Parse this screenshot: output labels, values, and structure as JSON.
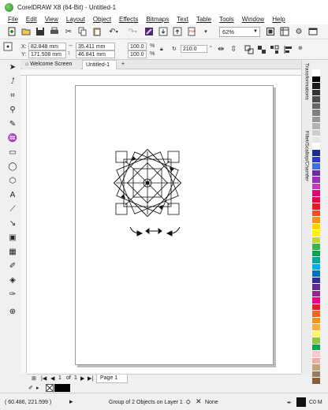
{
  "app": {
    "title": "CorelDRAW X8 (64-Bit) - Untitled-1"
  },
  "menu": [
    "File",
    "Edit",
    "View",
    "Layout",
    "Object",
    "Effects",
    "Bitmaps",
    "Text",
    "Table",
    "Tools",
    "Window",
    "Help"
  ],
  "toolbar": {
    "zoom": "62%"
  },
  "property_bar": {
    "x_label": "X:",
    "x": "82.848 mm",
    "y_label": "Y:",
    "y": "171.508 mm",
    "width": "35.411 mm",
    "height": "46.841 mm",
    "scale_x": "100.0",
    "scale_y": "100.0",
    "pct": "%",
    "angle": "210.0"
  },
  "tabs": [
    {
      "label": "Welcome Screen"
    },
    {
      "label": "Untitled-1"
    }
  ],
  "dockers": [
    "Transformations",
    "Fillet/Scallop/Chamfer"
  ],
  "page_nav": {
    "current": "1",
    "of_label": "of",
    "total": "1",
    "page_tab": "Page 1"
  },
  "status": {
    "coords": "( 60.486, 221.599 )",
    "selection": "Group of 2 Objects on Layer 1",
    "fill": "None",
    "outline": "C0 M"
  },
  "colors": {
    "palette": [
      "#ffffff",
      "#000000",
      "#1a1a1a",
      "#333333",
      "#4d4d4d",
      "#666666",
      "#808080",
      "#999999",
      "#b3b3b3",
      "#cccccc",
      "#e6e6e6",
      "#ffffff",
      "#1d2b8f",
      "#2a3ad1",
      "#3d6fe0",
      "#6a2ca0",
      "#9b2fb7",
      "#c73ab8",
      "#e0007a",
      "#e8004b",
      "#e21b23",
      "#f04e23",
      "#f7941d",
      "#ffd200",
      "#fff200",
      "#c3d82e",
      "#39b54a",
      "#00a651",
      "#00a99d",
      "#00aeef",
      "#0072bc",
      "#2e3192",
      "#662d91",
      "#92278f",
      "#ec008c",
      "#ed1c24",
      "#f26522",
      "#f7941d",
      "#fbaf3f",
      "#fff568",
      "#8dc63f",
      "#00a651",
      "#f9c8d0",
      "#e8b0a8",
      "#c7a27c",
      "#a0785a",
      "#8b5e3c"
    ]
  }
}
